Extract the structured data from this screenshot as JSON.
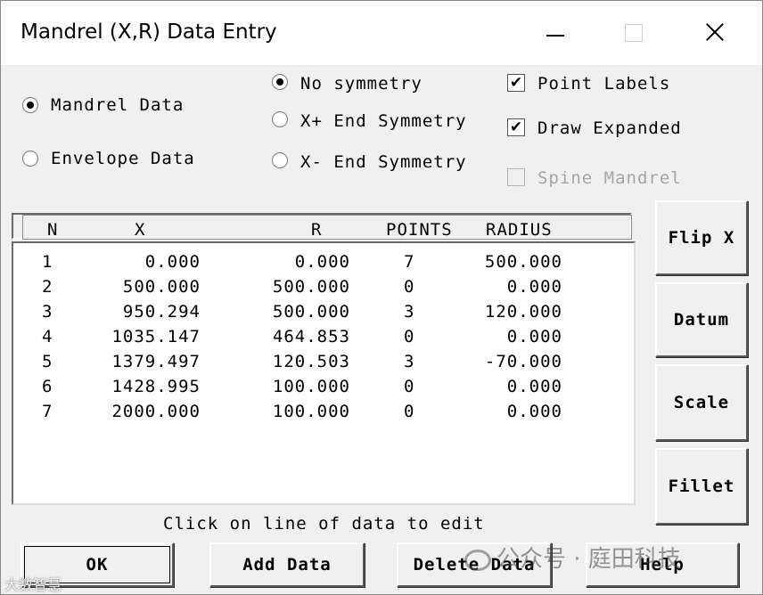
{
  "window": {
    "title": "Mandrel (X,R) Data Entry"
  },
  "data_type": {
    "options": [
      "Mandrel Data",
      "Envelope Data"
    ],
    "selected": "Mandrel Data"
  },
  "symmetry": {
    "options": [
      "No symmetry",
      "X+ End Symmetry",
      "X- End Symmetry"
    ],
    "selected": "No symmetry"
  },
  "options": {
    "point_labels": {
      "label": "Point Labels",
      "checked": true,
      "enabled": true
    },
    "draw_expanded": {
      "label": "Draw Expanded",
      "checked": true,
      "enabled": true
    },
    "spine_mandrel": {
      "label": "Spine Mandrel",
      "checked": false,
      "enabled": false
    }
  },
  "table": {
    "columns": [
      "N",
      "X",
      "R",
      "POINTS",
      "RADIUS"
    ],
    "rows": [
      [
        "1",
        "0.000",
        "0.000",
        "7",
        "500.000"
      ],
      [
        "2",
        "500.000",
        "500.000",
        "0",
        "0.000"
      ],
      [
        "3",
        "950.294",
        "500.000",
        "3",
        "120.000"
      ],
      [
        "4",
        "1035.147",
        "464.853",
        "0",
        "0.000"
      ],
      [
        "5",
        "1379.497",
        "120.503",
        "3",
        "-70.000"
      ],
      [
        "6",
        "1428.995",
        "100.000",
        "0",
        "0.000"
      ],
      [
        "7",
        "2000.000",
        "100.000",
        "0",
        "0.000"
      ]
    ]
  },
  "status_text": "Click on line of data to edit",
  "side_buttons": [
    "Flip X",
    "Datum",
    "Scale",
    "Fillet"
  ],
  "bottom_buttons": [
    "OK",
    "Add Data",
    "Delete Data",
    "Help"
  ],
  "watermark": {
    "main": "公众号 · 庭田科技",
    "corner": "大数智慧"
  }
}
